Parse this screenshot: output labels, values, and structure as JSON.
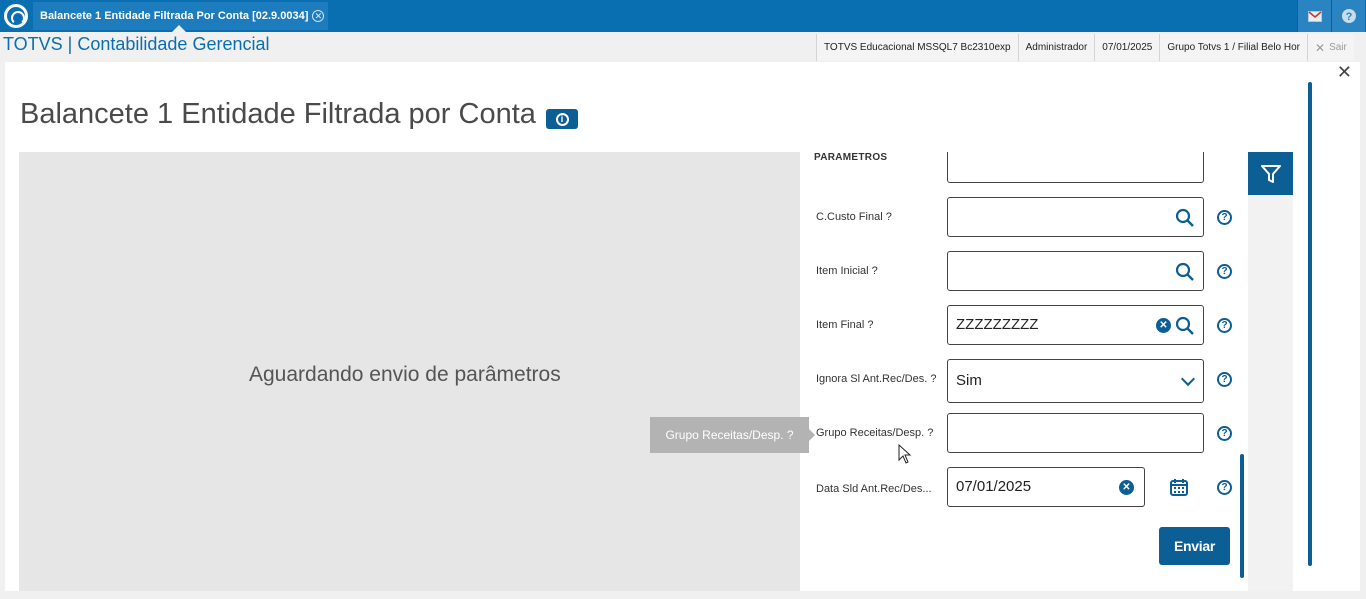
{
  "topbar": {
    "tab_label": "Balancete 1 Entidade Filtrada Por Conta [02.9.0034]",
    "tab_close": "✕",
    "mail_icon": "mail-icon",
    "help_icon": "help-icon"
  },
  "header": {
    "brand": "TOTVS | Contabilidade Gerencial",
    "environment": "TOTVS Educacional MSSQL7 Bc2310exp",
    "user": "Administrador",
    "date": "07/01/2025",
    "branch": "Grupo Totvs 1 / Filial Belo Hor",
    "sair": "Sair"
  },
  "dialog": {
    "close": "✕",
    "title": "Balancete 1 Entidade Filtrada por Conta",
    "preview_message": "Aguardando envio de parâmetros",
    "params_title": "PARAMETROS",
    "fields": [
      {
        "label": "C.Custo Final ?",
        "value": ""
      },
      {
        "label": "Item Inicial ?",
        "value": ""
      },
      {
        "label": "Item Final ?",
        "value": "ZZZZZZZZZ"
      },
      {
        "label": "Ignora Sl Ant.Rec/Des. ?",
        "value": "Sim"
      },
      {
        "label": "Grupo Receitas/Desp. ?",
        "value": ""
      },
      {
        "label": "Data Sld Ant.Rec/Des...",
        "value": "07/01/2025"
      }
    ],
    "send_button": "Enviar",
    "tooltip": "Grupo Receitas/Desp. ?"
  },
  "colors": {
    "brand": "#0a6fb0",
    "accent": "#0c5f95"
  }
}
